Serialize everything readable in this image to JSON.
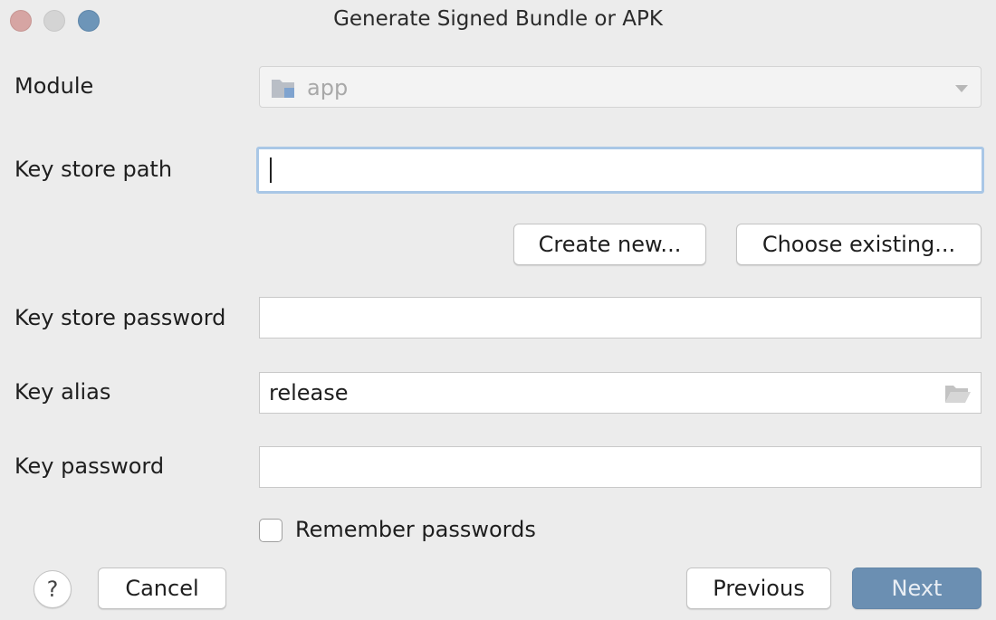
{
  "window": {
    "title": "Generate Signed Bundle or APK"
  },
  "module": {
    "label": "Module",
    "value": "app",
    "icon": "module-folder-icon"
  },
  "key_store_path": {
    "label": "Key store path",
    "value": ""
  },
  "buttons": {
    "create_new": "Create new...",
    "choose_existing": "Choose existing...",
    "cancel": "Cancel",
    "previous": "Previous",
    "next": "Next",
    "help": "?"
  },
  "key_store_password": {
    "label": "Key store password",
    "value": ""
  },
  "key_alias": {
    "label": "Key alias",
    "value": "release",
    "icon": "folder-open-icon"
  },
  "key_password": {
    "label": "Key password",
    "value": ""
  },
  "remember": {
    "label": "Remember passwords",
    "checked": false
  },
  "colors": {
    "primary_button": "#6b8fb2",
    "focus_ring": "#a9c7e6"
  }
}
